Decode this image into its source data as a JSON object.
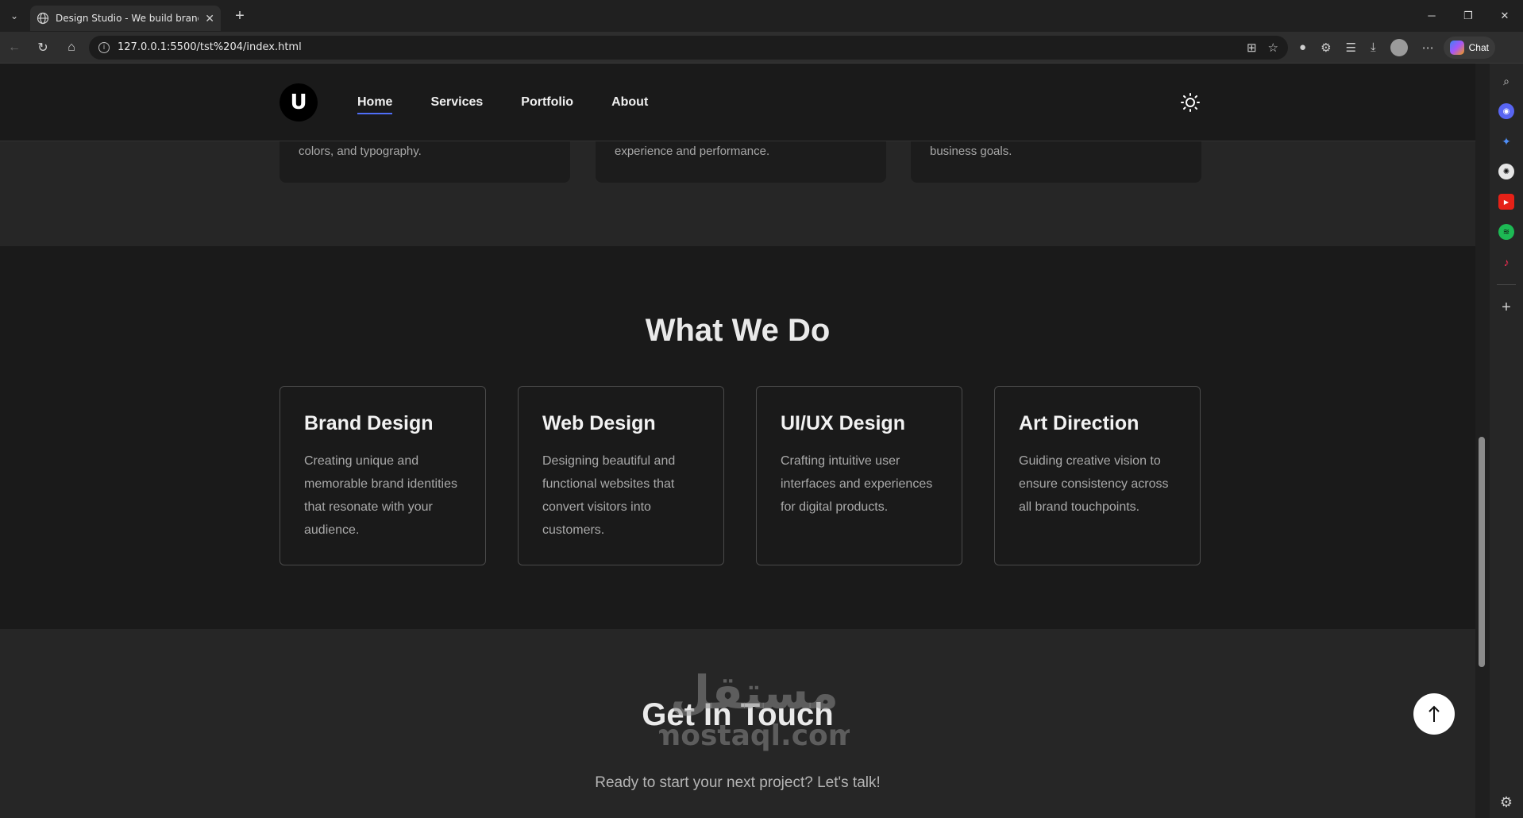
{
  "browser": {
    "tab_title": "Design Studio - We build brands f",
    "tab_close": "✕",
    "new_tab": "+",
    "url": "127.0.0.1:5500/tst%204/index.html",
    "copilot_label": "Chat"
  },
  "site": {
    "logo_letter": "U",
    "nav": [
      "Home",
      "Services",
      "Portfolio",
      "About"
    ],
    "active_nav": "Home",
    "card_snippets": [
      "colors, and typography.",
      "experience and performance.",
      "business goals."
    ]
  },
  "what_we_do": {
    "title": "What We Do",
    "cards": [
      {
        "title": "Brand Design",
        "text": "Creating unique and memorable brand identities that resonate with your audience."
      },
      {
        "title": "Web Design",
        "text": "Designing beautiful and functional websites that convert visitors into customers."
      },
      {
        "title": "UI/UX Design",
        "text": "Crafting intuitive user interfaces and experiences for digital products."
      },
      {
        "title": "Art Direction",
        "text": "Guiding creative vision to ensure consistency across all brand touchpoints."
      }
    ]
  },
  "contact": {
    "title": "Get In Touch",
    "subtitle": "Ready to start your next project? Let's talk!"
  },
  "watermark": {
    "arabic": "مستقل",
    "latin": "mostaql.com"
  },
  "colors": {
    "accent": "#4f6ef7",
    "page_bg": "#262626",
    "section_bg": "#1a1a1a"
  }
}
